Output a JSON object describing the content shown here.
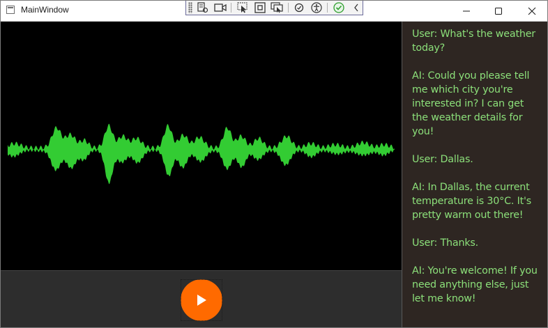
{
  "window": {
    "title": "MainWindow",
    "controls": [
      "minimize-icon",
      "maximize-icon",
      "close-icon"
    ]
  },
  "debug_toolbar": {
    "icons": [
      "live-visual-tree-icon",
      "camera-icon",
      "select-element-icon",
      "display-layout-adorners-icon",
      "track-focus-icon",
      "binding-failures-icon",
      "accessibility-icon",
      "hot-reload-ok-icon",
      "collapse-chevron-icon"
    ]
  },
  "waveform": {
    "color": "#33cc33",
    "background": "#000000"
  },
  "controls": {
    "play_button": {
      "icon": "play-icon",
      "color": "#ff6a00"
    }
  },
  "chat": {
    "text_color": "#8ce07a",
    "messages": [
      "User: What's the weather today?",
      "AI: Could you please tell me which city you're interested in? I can get the weather details for you!",
      "User: Dallas.",
      "AI: In Dallas, the current temperature is 30°C. It's pretty warm out there!",
      "User: Thanks.",
      "AI: You're welcome! If you need anything else, just let me know!"
    ]
  }
}
